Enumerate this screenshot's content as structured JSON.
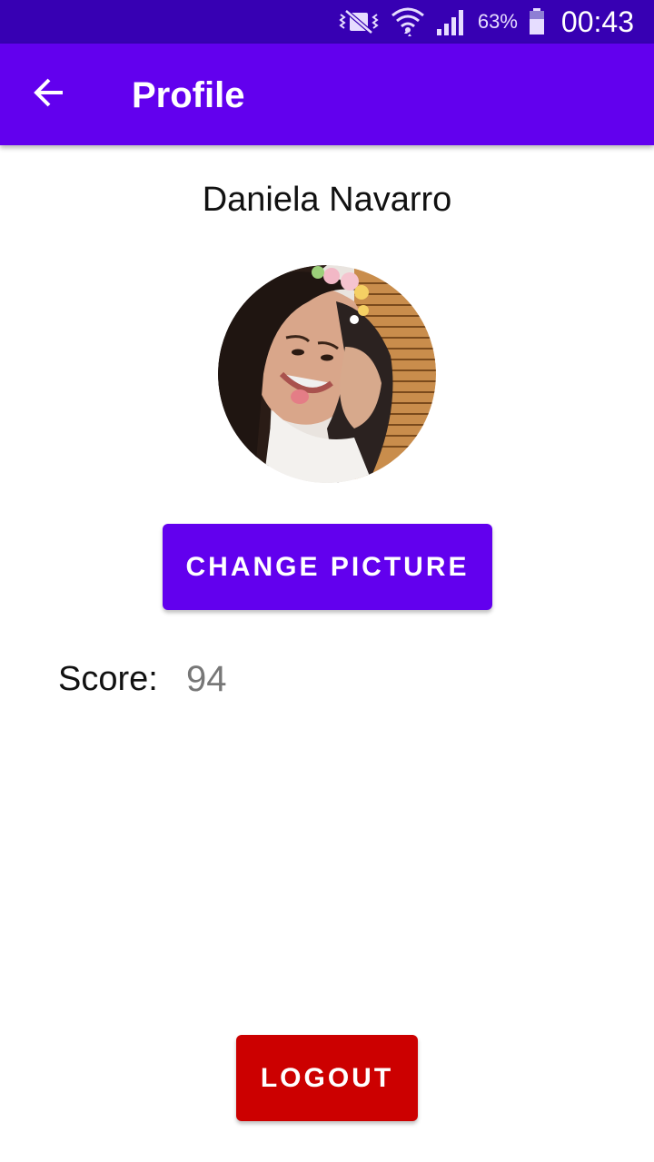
{
  "status_bar": {
    "battery_percent": "63%",
    "time": "00:43",
    "icons": [
      "mute-vibrate-icon",
      "wifi-icon",
      "signal-icon",
      "battery-icon"
    ]
  },
  "app_bar": {
    "title": "Profile",
    "back_icon": "arrow-back-icon"
  },
  "profile": {
    "name": "Daniela Navarro",
    "change_picture_label": "CHANGE PICTURE",
    "score_label": "Score:",
    "score_value": "94"
  },
  "actions": {
    "logout_label": "LOGOUT"
  },
  "colors": {
    "status_bar": "#3700b3",
    "primary": "#6200ee",
    "logout": "#cc0000",
    "score_value": "#777777"
  }
}
